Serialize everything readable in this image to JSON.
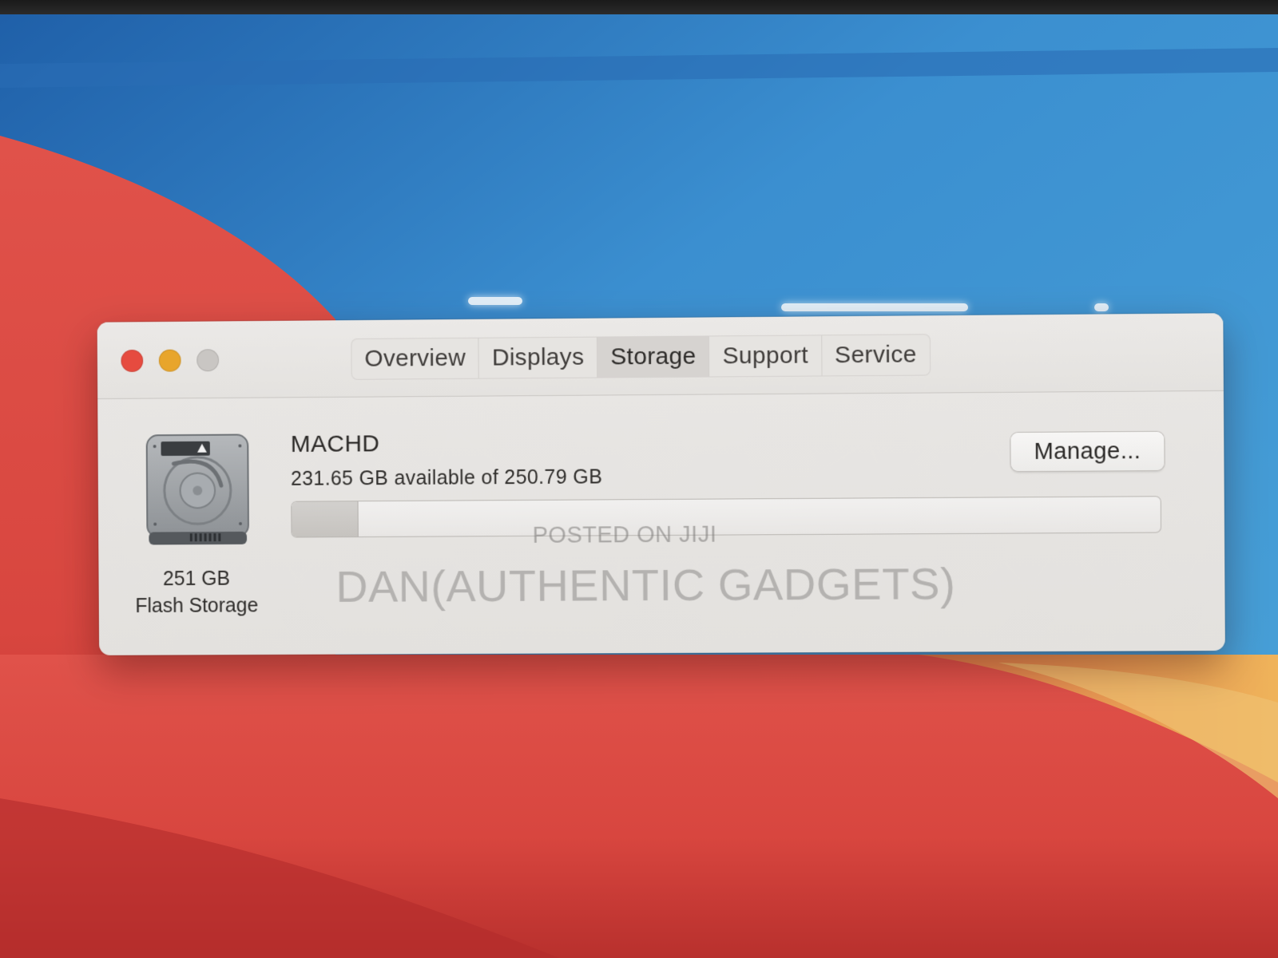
{
  "window": {
    "tabs": [
      {
        "label": "Overview",
        "selected": false
      },
      {
        "label": "Displays",
        "selected": false
      },
      {
        "label": "Storage",
        "selected": true
      },
      {
        "label": "Support",
        "selected": false
      },
      {
        "label": "Service",
        "selected": false
      }
    ]
  },
  "storage": {
    "drive_icon": "hard-drive-icon",
    "capacity_label": "251 GB",
    "type_label": "Flash Storage",
    "volume_name": "MACHD",
    "available_text": "231.65 GB available of 250.79 GB",
    "used_fraction": 0.0763,
    "manage_button": "Manage..."
  },
  "watermark": {
    "line1": "POSTED ON JIJI",
    "line2": "DAN(AUTHENTIC GADGETS)"
  },
  "colors": {
    "close": "#e64b3f",
    "minimize": "#e8a52b",
    "zoom": "#c9c6c3",
    "wallpaper_blue": "#2f7fc3",
    "wallpaper_red": "#d8463f",
    "wallpaper_orange": "#e9a04a"
  }
}
